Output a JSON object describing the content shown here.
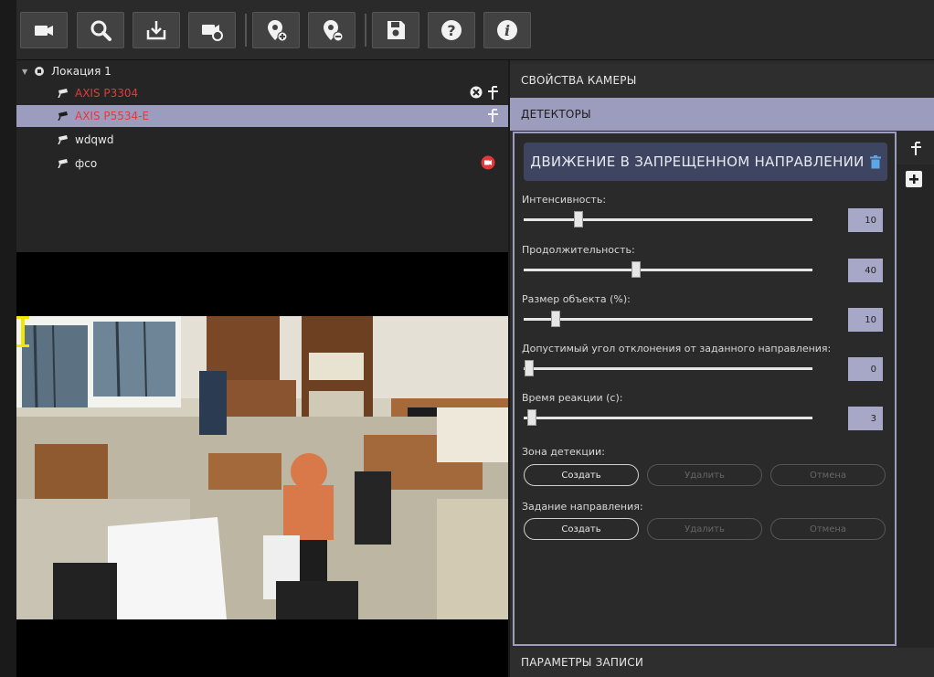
{
  "toolbar": {
    "buttons": [
      {
        "name": "add-camera-button",
        "icon": "camera-add-icon"
      },
      {
        "name": "search-button",
        "icon": "search-icon"
      },
      {
        "name": "import-button",
        "icon": "download-icon"
      },
      {
        "name": "camera-settings-button",
        "icon": "camera-gear-icon"
      },
      {
        "name": "add-location-button",
        "icon": "location-add-icon"
      },
      {
        "name": "remove-location-button",
        "icon": "location-remove-icon"
      },
      {
        "name": "save-button",
        "icon": "floppy-icon"
      },
      {
        "name": "help-button",
        "icon": "question-icon"
      },
      {
        "name": "info-button",
        "icon": "info-icon"
      }
    ]
  },
  "tree": {
    "root_label": "Локация 1",
    "items": [
      {
        "label": "AXIS P3304",
        "color": "#e23a3a",
        "status": "error"
      },
      {
        "label": "AXIS P5534-E",
        "color": "#e23a3a",
        "status": "selected"
      },
      {
        "label": "wdqwd",
        "color": "#e8e8e8",
        "status": "normal"
      },
      {
        "label": "фсо",
        "color": "#e8e8e8",
        "status": "recording"
      }
    ]
  },
  "right": {
    "camera_props": "СВОЙСТВА КАМЕРЫ",
    "detectors": "ДЕТЕКТОРЫ",
    "record_params": "ПАРАМЕТРЫ ЗАПИСИ",
    "detector_title": "ДВИЖЕНИЕ В ЗАПРЕЩЕННОМ НАПРАВЛЕНИИ",
    "params": [
      {
        "label": "Интенсивность:",
        "value": "10",
        "level": 0.19
      },
      {
        "label": "Продолжительность:",
        "value": "40",
        "level": 0.39
      },
      {
        "label": "Размер объекта (%):",
        "value": "10",
        "level": 0.11
      },
      {
        "label": "Допустимый угол отклонения от заданного направления:",
        "value": "0",
        "level": 0.02
      },
      {
        "label": "Время реакции (с):",
        "value": "3",
        "level": 0.03
      }
    ],
    "zone_label": "Зона детекции:",
    "direction_label": "Задание направления:",
    "btn_create": "Создать",
    "btn_delete": "Удалить",
    "btn_cancel": "Отмена"
  },
  "colors": {
    "accent": "#9c9cbf",
    "error_red": "#e23a3a",
    "title_bg": "#3e4560"
  }
}
